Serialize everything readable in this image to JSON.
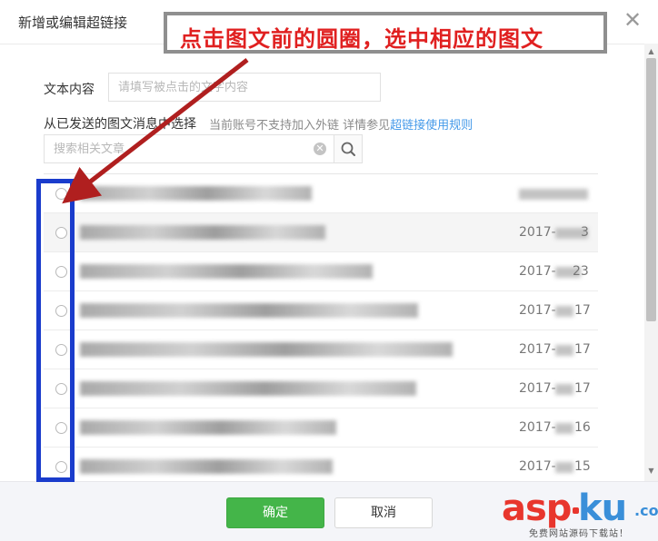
{
  "dialog": {
    "title": "新增或编辑超链接",
    "close_glyph": "✕"
  },
  "annotation": {
    "callout_text": "点击图文前的圆圈，选中相应的图文",
    "callout_color": "#e02020",
    "highlight_color": "#1a3ccc"
  },
  "form": {
    "text_label": "文本内容",
    "text_placeholder": "请填写被点击的文字内容",
    "from_label": "从已发送的图文消息中选择",
    "hint_text": "当前账号不支持加入外链 详情参见",
    "hint_link": "超链接使用规则",
    "search_placeholder": "搜索相关文章"
  },
  "articles": [
    {
      "title": "[redacted]",
      "date": ""
    },
    {
      "title": "[redacted]",
      "date": "2017-"
    },
    {
      "title": "[redacted]",
      "date": "2017-"
    },
    {
      "title": "[redacted]",
      "date": "2017-"
    },
    {
      "title": "[redacted]",
      "date": "2017-"
    },
    {
      "title": "[redacted]",
      "date": "2017-"
    },
    {
      "title": "[redacted]",
      "date": "2017-"
    },
    {
      "title": "[redacted]",
      "date": "2017-"
    }
  ],
  "date_suffixes": [
    "",
    "3",
    "23",
    "17",
    "17",
    "17",
    "16",
    "15"
  ],
  "footer": {
    "ok_label": "确定",
    "cancel_label": "取消",
    "ok_color": "#44b549"
  },
  "watermark": {
    "brand_asp": "asp",
    "brand_ku": "ku",
    "brand_com": ".com",
    "tagline": "免费网站源码下载站！"
  },
  "icons": {
    "close": "close-icon",
    "search": "search-icon",
    "clear": "clear-icon",
    "scroll_up": "scroll-up-icon",
    "scroll_down": "scroll-down-icon"
  }
}
